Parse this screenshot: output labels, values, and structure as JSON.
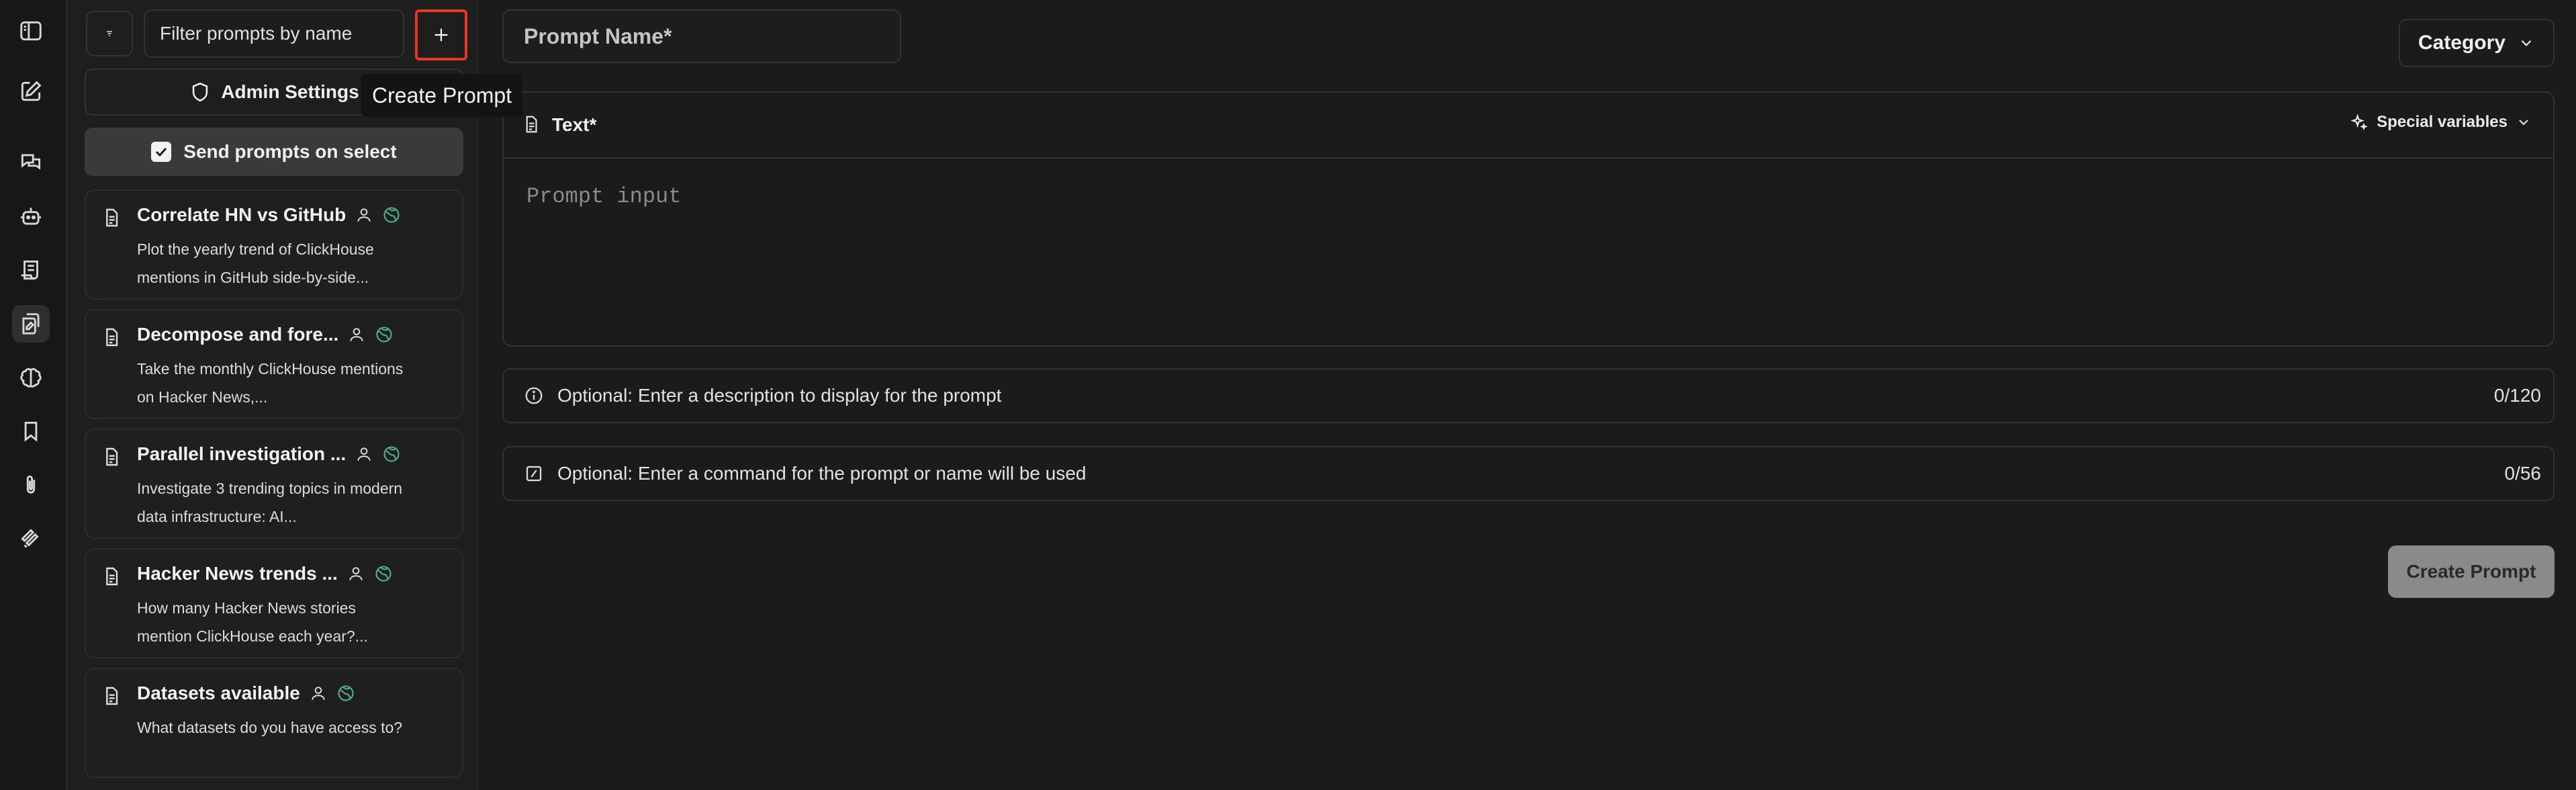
{
  "sidebar_filter": {
    "placeholder": "Filter prompts by name"
  },
  "admin_settings_label": "Admin Settings",
  "tooltip_text": "Create Prompt",
  "send_on_select_label": "Send prompts on select",
  "prompts": [
    {
      "title": "Correlate HN vs GitHub",
      "desc": "Plot the yearly trend of ClickHouse mentions in GitHub side-by-side..."
    },
    {
      "title": "Decompose and fore...",
      "desc": "Take the monthly ClickHouse mentions on Hacker News,..."
    },
    {
      "title": "Parallel investigation ...",
      "desc": "Investigate 3 trending topics in modern data infrastructure: AI..."
    },
    {
      "title": "Hacker News trends ...",
      "desc": "How many Hacker News stories mention ClickHouse each year?..."
    },
    {
      "title": "Datasets available",
      "desc": "What datasets do you have access to?"
    }
  ],
  "editor": {
    "name_placeholder": "Prompt Name*",
    "category_label": "Category",
    "text_label": "Text*",
    "special_variables_label": "Special variables",
    "prompt_input_placeholder": "Prompt input",
    "description_placeholder": "Optional: Enter a description to display for the prompt",
    "description_count": "0/120",
    "command_placeholder": "Optional: Enter a command for the prompt or name will be used",
    "command_count": "0/56",
    "create_button_label": "Create Prompt"
  },
  "colors": {
    "highlight": "#e53925",
    "global_badge": "#4fb38a"
  },
  "icons": {
    "rail": [
      "sidebar-toggle-icon",
      "new-chat-icon",
      "chats-icon",
      "bot-icon",
      "notes-icon",
      "prompts-icon",
      "brain-icon",
      "bookmark-icon",
      "paperclip-icon",
      "plugin-icon"
    ]
  }
}
